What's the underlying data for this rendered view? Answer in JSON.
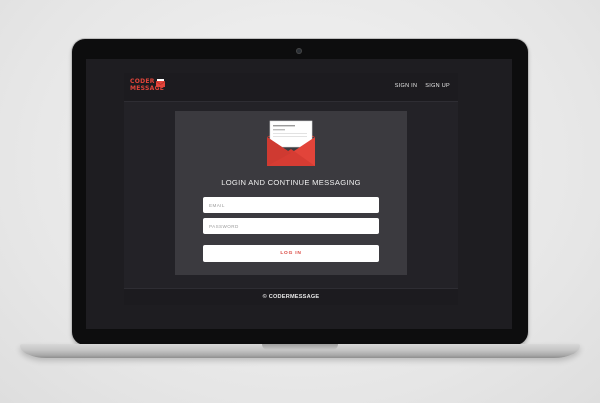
{
  "site": {
    "logo": {
      "line1": "CODER",
      "line2": "MESSAGE"
    },
    "nav": [
      {
        "label": "SIGN IN"
      },
      {
        "label": "SIGN UP"
      }
    ]
  },
  "login": {
    "heading": "LOGIN AND CONTINUE MESSAGING",
    "email_placeholder": "EMAIL",
    "password_placeholder": "PASSWORD",
    "button_label": "LOG IN"
  },
  "footer": {
    "text": "© CODERMESSAGE"
  },
  "colors": {
    "accent": "#e2443a",
    "page_background": "#232227",
    "panel": "#3b3a3f",
    "bar": "#1c1b1f"
  },
  "icons": {
    "logo_mark": "envelope-icon",
    "hero": "envelope-letter-icon"
  }
}
